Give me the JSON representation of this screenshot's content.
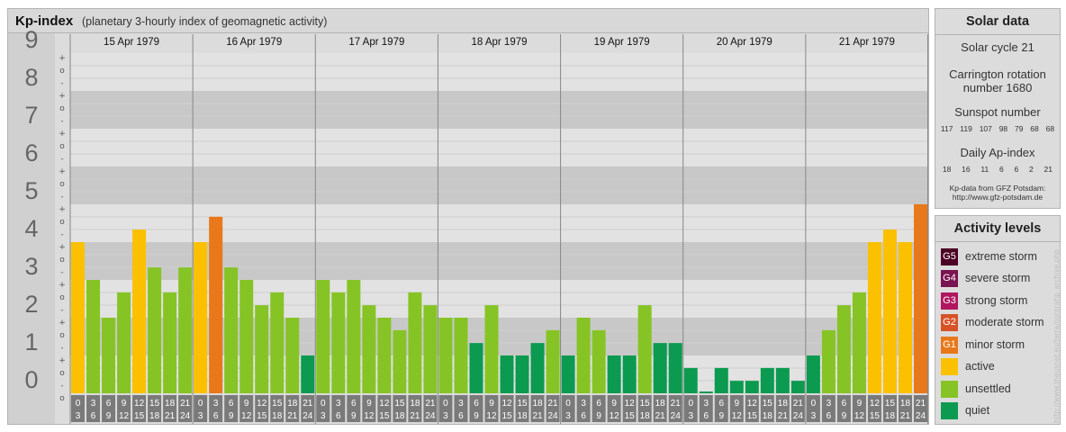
{
  "header": {
    "title": "Kp-index",
    "subtitle": "(planetary 3-hourly index of geomagnetic activity)"
  },
  "chart_data": {
    "type": "bar",
    "title": "Kp-index",
    "subtitle": "(planetary 3-hourly index of geomagnetic activity)",
    "ylim": [
      0,
      9
    ],
    "y_ticks": [
      "0",
      "1",
      "2",
      "3",
      "4",
      "5",
      "6",
      "7",
      "8",
      "9"
    ],
    "minor_tick_marks": [
      "+",
      "o",
      "-"
    ],
    "grid": true,
    "days": [
      "15 Apr 1979",
      "16 Apr 1979",
      "17 Apr 1979",
      "18 Apr 1979",
      "19 Apr 1979",
      "20 Apr 1979",
      "21 Apr 1979"
    ],
    "interval_labels": [
      [
        "0",
        "3"
      ],
      [
        "3",
        "6"
      ],
      [
        "6",
        "9"
      ],
      [
        "9",
        "12"
      ],
      [
        "12",
        "15"
      ],
      [
        "15",
        "18"
      ],
      [
        "18",
        "21"
      ],
      [
        "21",
        "24"
      ]
    ],
    "values": [
      [
        4.0,
        3.0,
        2.0,
        2.67,
        4.33,
        3.33,
        2.67,
        3.33
      ],
      [
        4.0,
        4.67,
        3.33,
        3.0,
        2.33,
        2.67,
        2.0,
        1.0
      ],
      [
        3.0,
        2.67,
        3.0,
        2.33,
        2.0,
        1.67,
        2.67,
        2.33
      ],
      [
        2.0,
        2.0,
        1.33,
        2.33,
        1.0,
        1.0,
        1.33,
        1.67
      ],
      [
        1.0,
        2.0,
        1.67,
        1.0,
        1.0,
        2.33,
        1.33,
        1.33
      ],
      [
        0.67,
        0.0,
        0.67,
        0.33,
        0.33,
        0.67,
        0.67,
        0.33
      ],
      [
        1.0,
        1.67,
        2.33,
        2.67,
        4.0,
        4.33,
        4.0,
        5.0
      ]
    ],
    "colors": {
      "quiet": "#0c9a50",
      "unsettled": "#86c426",
      "active": "#fbc100",
      "minor_storm": "#e8781a",
      "moderate_storm": "#d75227",
      "strong_storm": "#b0175f",
      "severe_storm": "#7a1351",
      "extreme_storm": "#4d0025",
      "band_dark": "#c8c8c8",
      "band_light": "#e2e2e2",
      "interval_box": "#7a7a7a"
    }
  },
  "solar": {
    "header": "Solar data",
    "cycle": "Solar cycle 21",
    "carrington_1": "Carrington rotation",
    "carrington_2": "number 1680",
    "sunspot_label": "Sunspot number",
    "sunspot_numbers": [
      "117",
      "119",
      "107",
      "98",
      "79",
      "68",
      "68"
    ],
    "ap_label": "Daily Ap-index",
    "ap_values": [
      "18",
      "16",
      "11",
      "6",
      "6",
      "2",
      "21"
    ],
    "source_1": "Kp-data from GFZ Potsdam:",
    "source_2": "http://www.gfz-potsdam.de"
  },
  "activity_levels": {
    "header": "Activity levels",
    "items": [
      {
        "badge": "G5",
        "label": "extreme storm",
        "color": "#4d0025"
      },
      {
        "badge": "G4",
        "label": "severe storm",
        "color": "#7a1351"
      },
      {
        "badge": "G3",
        "label": "strong storm",
        "color": "#b0175f"
      },
      {
        "badge": "G2",
        "label": "moderate storm",
        "color": "#d75227"
      },
      {
        "badge": "G1",
        "label": "minor storm",
        "color": "#e8781a"
      },
      {
        "badge": "",
        "label": "active",
        "color": "#fbc100"
      },
      {
        "badge": "",
        "label": "unsettled",
        "color": "#86c426"
      },
      {
        "badge": "",
        "label": "quiet",
        "color": "#0c9a50"
      }
    ]
  },
  "credit": "http://www.theusner.eu/terra/ourorahp_archive.php"
}
